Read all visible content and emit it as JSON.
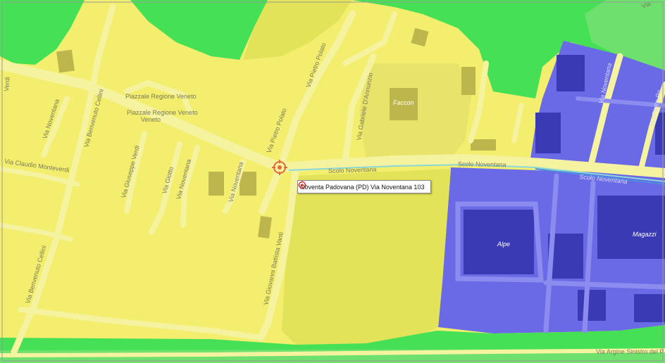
{
  "map": {
    "colors": {
      "coverage_yellow": "#f3ee6e",
      "coverage_lightyellow": "#e3e35a",
      "coverage_green": "#46e056",
      "coverage_lightgreen": "#6ee06e",
      "coverage_blue": "#6a6ae6",
      "road_fill": "#f6f3a0",
      "building": "#bdb64c",
      "marker": "#e06a3a"
    },
    "street_labels": {
      "via_noventana_nw": "Via Noventana",
      "via_benvenuto_cellini_n": "Via Benvenuto Cellini",
      "piazzale_regione_veneto_1": "Piazzale Regione Veneto",
      "piazzale_regione_veneto_2": "Piazzale Regione Veneto",
      "via_pietro_polato_n": "Via Pietro Polato",
      "via_pietro_polato_s": "Via Pietro Polato",
      "via_gabriele_dannunzio": "Via Gabriele D'Annunzio",
      "faccon": "Faccon",
      "via_noventana_ne": "Via Noventana",
      "via_pietro_ne": "Via Pietro Po",
      "via_claudio_monteverdi": "Via Claudio Monteverdi",
      "via_giuseppe_verdi": "Via Giuseppe Verdi",
      "via_giotto": "Via Giotto",
      "via_noventana_mid": "Via Noventana",
      "via_noventana_mid2": "Via Noventana",
      "scolo_noventana_1": "Scolo Noventana",
      "scolo_noventana_2": "Scolo Noventana",
      "scolo_noventana_3": "Scolo Noventana",
      "via_benvenuto_cellini_s": "Via Benvenuto Cellini",
      "via_giovanni_battista_vanti": "Via Giovanni Battista Vanti",
      "alpe": "Alpe",
      "magazzini": "Magazzi",
      "via_argine_sinistro": "Via Argine Sinistro del P",
      "via_top_right": "Via",
      "via_left_edge": "Verdi"
    },
    "popup": {
      "text": "Noventa Padovana (PD) Via Noventana 103",
      "icon": "target-marker-icon"
    }
  }
}
